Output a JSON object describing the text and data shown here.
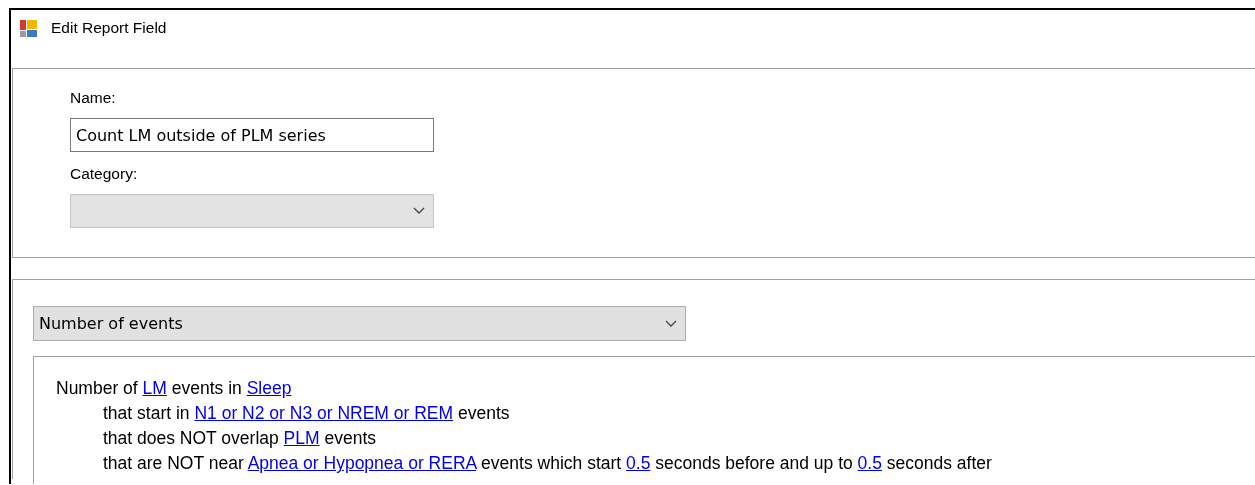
{
  "window": {
    "title": "Edit Report Field"
  },
  "name_field": {
    "label": "Name:",
    "value": "Count LM outside of PLM series"
  },
  "category_field": {
    "label": "Category:",
    "disabled": true
  },
  "measure_combo": {
    "value": "Number of events"
  },
  "rule_lines": [
    {
      "parts": [
        {
          "text": "Number of ",
          "link": false
        },
        {
          "text": "LM",
          "link": true
        },
        {
          "text": " events in ",
          "link": false
        },
        {
          "text": "Sleep",
          "link": true
        }
      ],
      "children": [
        {
          "parts": [
            {
              "text": "that start in ",
              "link": false
            },
            {
              "text": "N1 or N2 or N3 or NREM or REM",
              "link": true
            },
            {
              "text": " events",
              "link": false
            }
          ]
        },
        {
          "parts": [
            {
              "text": "that does NOT overlap ",
              "link": false
            },
            {
              "text": "PLM",
              "link": true
            },
            {
              "text": " events",
              "link": false
            }
          ]
        },
        {
          "parts": [
            {
              "text": "that are NOT near ",
              "link": false
            },
            {
              "text": "Apnea or Hypopnea or RERA",
              "link": true
            },
            {
              "text": " events which start ",
              "link": false
            },
            {
              "text": "0.5",
              "link": true
            },
            {
              "text": " seconds before and up to ",
              "link": false
            },
            {
              "text": "0.5",
              "link": true
            },
            {
              "text": " seconds after",
              "link": false
            }
          ]
        }
      ]
    }
  ]
}
